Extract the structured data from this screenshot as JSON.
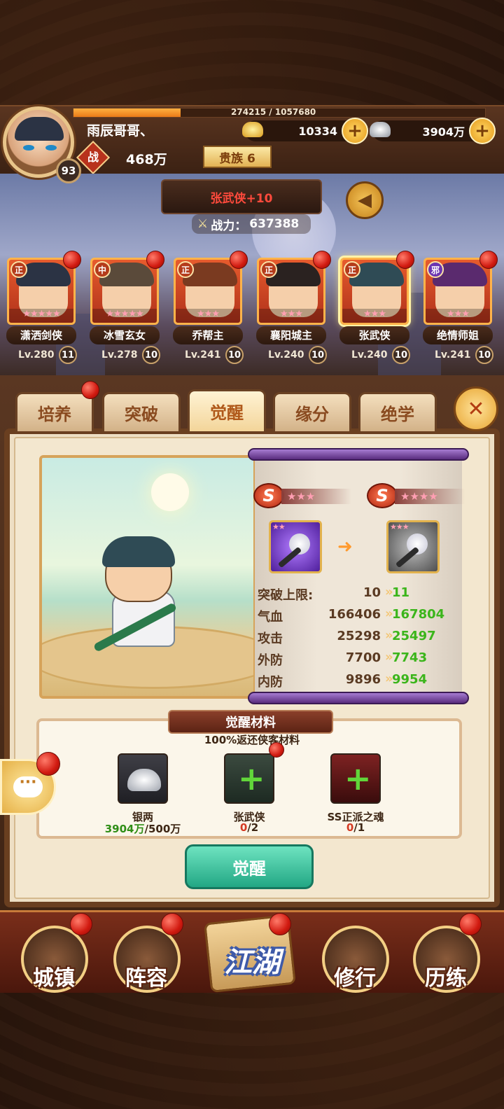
{
  "player": {
    "name": "雨辰哥哥、",
    "level": "93",
    "exp_text": "274215 / 1057680",
    "exp_progress": 0.26,
    "gold": "10334",
    "silver": "3904万",
    "power_icon": "战",
    "power": "468万",
    "noble": "贵族 6"
  },
  "hero_header": {
    "title": "张武侠+10",
    "battle_power_label": "战力：",
    "battle_power": "637388"
  },
  "heroes": [
    {
      "name": "潇洒剑侠",
      "faction": "正",
      "level": "Lv.280",
      "badge": "11",
      "stars": "★★★★★",
      "hair": "#2b3344",
      "selected": false
    },
    {
      "name": "冰雪玄女",
      "faction": "中",
      "level": "Lv.278",
      "badge": "10",
      "stars": "★★★★★",
      "hair": "#5a4a3a",
      "selected": false
    },
    {
      "name": "乔帮主",
      "faction": "正",
      "level": "Lv.241",
      "badge": "10",
      "stars": "★★★",
      "hair": "#7a3a20",
      "selected": false
    },
    {
      "name": "襄阳城主",
      "faction": "正",
      "level": "Lv.240",
      "badge": "10",
      "stars": "★★★",
      "hair": "#2a2220",
      "selected": false
    },
    {
      "name": "张武侠",
      "faction": "正",
      "level": "Lv.240",
      "badge": "10",
      "stars": "★★★",
      "hair": "#2f4b55",
      "selected": true
    },
    {
      "name": "绝情师姐",
      "faction": "邪",
      "level": "Lv.241",
      "badge": "10",
      "stars": "★★★",
      "hair": "#5a2a6e",
      "selected": false
    }
  ],
  "tabs": [
    "培养",
    "突破",
    "觉醒",
    "缘分",
    "绝学"
  ],
  "active_tab": 2,
  "awaken": {
    "grade_from": {
      "letter": "S",
      "stars": "★★★"
    },
    "grade_to": {
      "letter": "S",
      "stars": "★★★★"
    },
    "weapon_from_stars": "★★",
    "weapon_to_stars": "★★★",
    "stats": [
      {
        "name": "突破上限:",
        "old": "10",
        "new": "11"
      },
      {
        "name": "气血",
        "old": "166406",
        "new": "167804"
      },
      {
        "name": "攻击",
        "old": "25298",
        "new": "25497"
      },
      {
        "name": "外防",
        "old": "7700",
        "new": "7743"
      },
      {
        "name": "内防",
        "old": "9896",
        "new": "9954"
      }
    ],
    "materials_title": "觉醒材料",
    "materials_subtitle": "100%返还侠客材料",
    "materials": [
      {
        "name": "银两",
        "have": "3904万",
        "need": "/500万"
      },
      {
        "name": "张武侠",
        "have": "0",
        "need": "/2"
      },
      {
        "name": "SS正派之魂",
        "have": "0",
        "need": "/1"
      }
    ],
    "button": "觉醒"
  },
  "bottom_nav": [
    "城镇",
    "阵容",
    "江湖",
    "修行",
    "历练"
  ],
  "colors": {
    "accent_orange": "#e97a18",
    "stat_green": "#3bb51b",
    "red_text": "#ff4a3c",
    "button_teal": "#22a784"
  }
}
